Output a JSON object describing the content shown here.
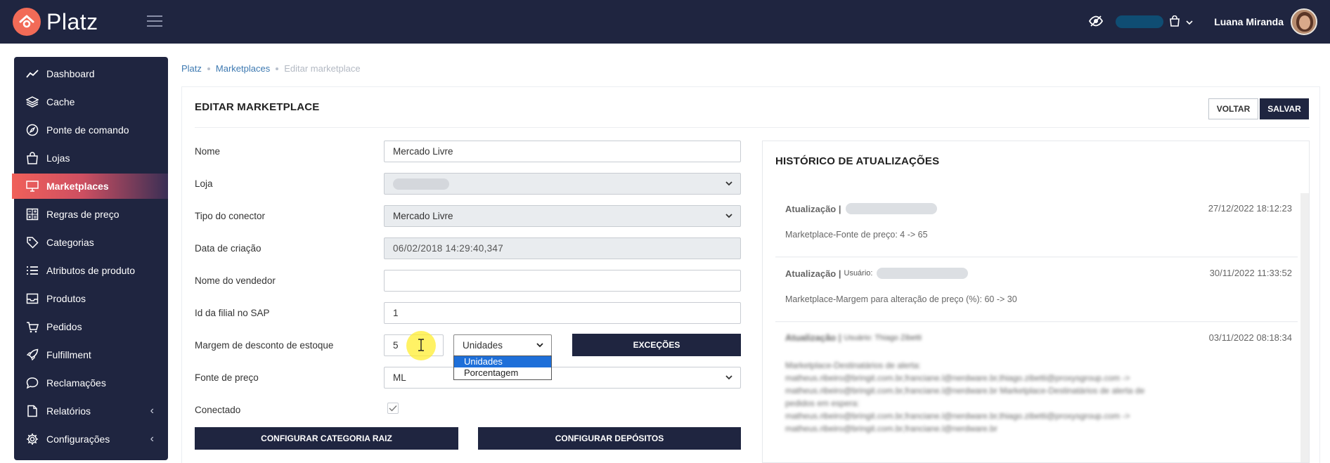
{
  "app": {
    "name": "Platz"
  },
  "header": {
    "user_name": "Luana Miranda"
  },
  "sidebar": {
    "items": [
      {
        "label": "Dashboard",
        "icon": "trend-line-icon"
      },
      {
        "label": "Cache",
        "icon": "layers-icon"
      },
      {
        "label": "Ponte de comando",
        "icon": "compass-icon"
      },
      {
        "label": "Lojas",
        "icon": "shopping-bag-icon"
      },
      {
        "label": "Marketplaces",
        "icon": "monitor-icon",
        "active": true
      },
      {
        "label": "Regras de preço",
        "icon": "calculator-icon"
      },
      {
        "label": "Categorias",
        "icon": "tag-icon"
      },
      {
        "label": "Atributos de produto",
        "icon": "list-icon"
      },
      {
        "label": "Produtos",
        "icon": "inbox-icon"
      },
      {
        "label": "Pedidos",
        "icon": "basket-icon"
      },
      {
        "label": "Fulfillment",
        "icon": "rocket-icon"
      },
      {
        "label": "Reclamações",
        "icon": "chat-icon"
      },
      {
        "label": "Relatórios",
        "icon": "file-icon",
        "chevron": "‹"
      },
      {
        "label": "Configurações",
        "icon": "gear-icon",
        "chevron": "‹"
      }
    ]
  },
  "breadcrumb": {
    "root": "Platz",
    "parent": "Marketplaces",
    "current": "Editar marketplace"
  },
  "page": {
    "title": "EDITAR MARKETPLACE",
    "back_label": "VOLTAR",
    "save_label": "SALVAR"
  },
  "form": {
    "nome_label": "Nome",
    "nome_value": "Mercado Livre",
    "loja_label": "Loja",
    "tipo_label": "Tipo do conector",
    "tipo_value": "Mercado Livre",
    "data_label": "Data de criação",
    "data_value": "06/02/2018 14:29:40,347",
    "vendedor_label": "Nome do vendedor",
    "vendedor_value": "",
    "filial_label": "Id da filial no SAP",
    "filial_value": "1",
    "margem_label": "Margem de desconto de estoque",
    "margem_value": "5",
    "unidade_value": "Unidades",
    "unidade_options": [
      "Unidades",
      "Porcentagem"
    ],
    "excecoes_label": "EXCEÇÕES",
    "fonte_label": "Fonte de preço",
    "fonte_value": "ML",
    "conectado_label": "Conectado",
    "conectado_checked": true,
    "config_categoria_label": "CONFIGURAR CATEGORIA RAIZ",
    "config_depositos_label": "CONFIGURAR DEPÓSITOS"
  },
  "history": {
    "title": "HISTÓRICO DE ATUALIZAÇÕES",
    "entries": [
      {
        "label": "Atualização |",
        "user_prefix": "",
        "date": "27/12/2022 18:12:23",
        "description": "Marketplace-Fonte de preço: 4 -> 65"
      },
      {
        "label": "Atualização |",
        "user_prefix": "Usuário:",
        "date": "30/11/2022 11:33:52",
        "description": "Marketplace-Margem para alteração de preço (%): 60 -> 30"
      },
      {
        "label": "Atualização |",
        "user_prefix": "Usuário: Thiago Zibetti",
        "date": "03/11/2022 08:18:34",
        "description_lines": [
          "Marketplace-Destinatários de alerta:",
          "matheus.ribeiro@bringit.com.br,franciane.l@nerdware.br,thiago.zibetti@proxysgroup.com ->",
          "matheus.ribeiro@bringit.com.br,franciane.l@nerdware.br Marketplace-Destinatários de alerta de",
          "pedidos em espera:",
          "matheus.ribeiro@bringit.com.br,franciane.l@nerdware.br,thiago.zibetti@proxysgroup.com ->",
          "matheus.ribeiro@bringit.com.br,franciane.l@nerdware.br"
        ]
      }
    ]
  }
}
